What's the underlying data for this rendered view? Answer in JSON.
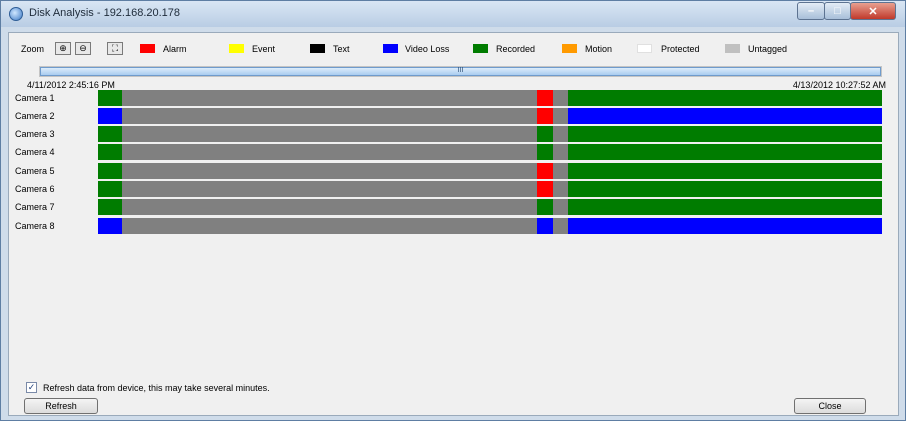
{
  "window": {
    "title": "Disk Analysis - 192.168.20.178"
  },
  "colors": {
    "alarm": "#ff0000",
    "event": "#ffff00",
    "text": "#000000",
    "video_loss": "#0000ff",
    "recorded": "#007c00",
    "motion": "#ff9a00",
    "protected": "#ffffff",
    "untagged": "#c0c0c0",
    "gray_bar": "#808080"
  },
  "legend": {
    "zoom_label": "Zoom",
    "items": [
      {
        "key": "alarm",
        "label": "Alarm"
      },
      {
        "key": "event",
        "label": "Event"
      },
      {
        "key": "text",
        "label": "Text"
      },
      {
        "key": "video_loss",
        "label": "Video Loss"
      },
      {
        "key": "recorded",
        "label": "Recorded"
      },
      {
        "key": "motion",
        "label": "Motion"
      },
      {
        "key": "protected",
        "label": "Protected"
      },
      {
        "key": "untagged",
        "label": "Untagged"
      }
    ]
  },
  "timeline": {
    "start_time": "4/11/2012 2:45:16 PM",
    "end_time": "4/13/2012 10:27:52 AM",
    "scrollbar_grip": "III"
  },
  "cameras": [
    {
      "name": "Camera 1",
      "segments": [
        [
          "recorded",
          0,
          3
        ],
        [
          "gray_bar",
          3,
          56
        ],
        [
          "alarm",
          56,
          58
        ],
        [
          "gray_bar",
          58,
          60
        ],
        [
          "recorded",
          60,
          100
        ]
      ]
    },
    {
      "name": "Camera 2",
      "segments": [
        [
          "video_loss",
          0,
          3
        ],
        [
          "gray_bar",
          3,
          56
        ],
        [
          "alarm",
          56,
          58
        ],
        [
          "gray_bar",
          58,
          60
        ],
        [
          "video_loss",
          60,
          100
        ]
      ]
    },
    {
      "name": "Camera 3",
      "segments": [
        [
          "recorded",
          0,
          3
        ],
        [
          "gray_bar",
          3,
          56
        ],
        [
          "recorded",
          56,
          58
        ],
        [
          "gray_bar",
          58,
          60
        ],
        [
          "recorded",
          60,
          100
        ]
      ]
    },
    {
      "name": "Camera 4",
      "segments": [
        [
          "recorded",
          0,
          3
        ],
        [
          "gray_bar",
          3,
          56
        ],
        [
          "recorded",
          56,
          58
        ],
        [
          "gray_bar",
          58,
          60
        ],
        [
          "recorded",
          60,
          100
        ]
      ]
    },
    {
      "name": "Camera 5",
      "segments": [
        [
          "recorded",
          0,
          3
        ],
        [
          "gray_bar",
          3,
          56
        ],
        [
          "alarm",
          56,
          58
        ],
        [
          "gray_bar",
          58,
          60
        ],
        [
          "recorded",
          60,
          100
        ]
      ]
    },
    {
      "name": "Camera 6",
      "segments": [
        [
          "recorded",
          0,
          3
        ],
        [
          "gray_bar",
          3,
          56
        ],
        [
          "alarm",
          56,
          58
        ],
        [
          "gray_bar",
          58,
          60
        ],
        [
          "recorded",
          60,
          100
        ]
      ]
    },
    {
      "name": "Camera 7",
      "segments": [
        [
          "recorded",
          0,
          3
        ],
        [
          "gray_bar",
          3,
          56
        ],
        [
          "recorded",
          56,
          58
        ],
        [
          "gray_bar",
          58,
          60
        ],
        [
          "recorded",
          60,
          100
        ]
      ]
    },
    {
      "name": "Camera 8",
      "segments": [
        [
          "video_loss",
          0,
          3
        ],
        [
          "gray_bar",
          3,
          56
        ],
        [
          "video_loss",
          56,
          58
        ],
        [
          "gray_bar",
          58,
          60
        ],
        [
          "video_loss",
          60,
          100
        ]
      ]
    }
  ],
  "footer": {
    "refresh_checkbox_checked": true,
    "refresh_checkbox_label": "Refresh data from device, this may take several minutes.",
    "refresh_button": "Refresh",
    "close_button": "Close"
  }
}
